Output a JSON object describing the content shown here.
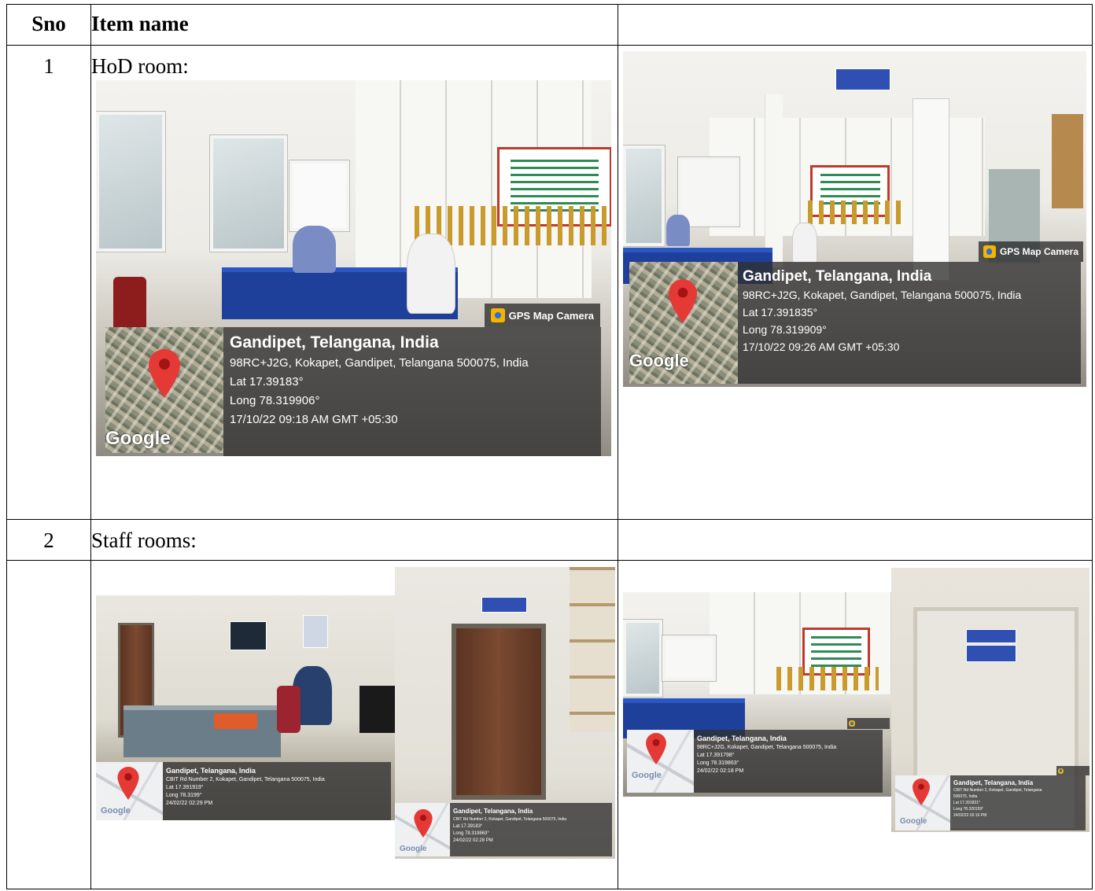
{
  "table": {
    "headers": {
      "sno": "Sno",
      "item": "Item name",
      "extra": ""
    },
    "rows": [
      {
        "sno": "1",
        "label": "HoD room:"
      },
      {
        "sno": "2",
        "label": "Staff rooms:"
      }
    ]
  },
  "photos": {
    "hod_left": {
      "badge": "GPS Map Camera",
      "place": "Gandipet, Telangana, India",
      "address": "98RC+J2G, Kokapet, Gandipet, Telangana 500075, India",
      "lat": "Lat 17.39183°",
      "long": "Long 78.319906°",
      "time": "17/10/22 09:18 AM GMT +05:30",
      "logo": "Google"
    },
    "hod_right": {
      "badge": "GPS Map Camera",
      "place": "Gandipet, Telangana, India",
      "address": "98RC+J2G, Kokapet, Gandipet, Telangana 500075, India",
      "lat": "Lat 17.391835°",
      "long": "Long 78.319909°",
      "time": "17/10/22 09:26 AM GMT +05:30",
      "logo": "Google"
    },
    "staff_1": {
      "place": "Gandipet, Telangana, India",
      "address": "CBIT Rd Number 2, Kokapet, Gandipet, Telangana 500075, India",
      "lat": "Lat 17.391919°",
      "long": "Long 78.3199°",
      "time": "24/02/22 02:29 PM",
      "logo": "Google"
    },
    "staff_2": {
      "place": "Gandipet, Telangana, India",
      "address": "CBIT Rd Number 2, Kokapet, Gandipet, Telangana 500075, India",
      "lat": "Lat 17.39183°",
      "long": "Long 78.319863°",
      "time": "24/02/22 02:28 PM",
      "logo": "Google"
    },
    "staff_3": {
      "place": "Gandipet, Telangana, India",
      "address": "98RC+J2G, Kokapet, Gandipet, Telangana 500075, India",
      "lat": "Lat 17.391798°",
      "long": "Long 78.319863°",
      "time": "24/02/22 02:18 PM",
      "logo": "Google"
    },
    "staff_4": {
      "place": "Gandipet, Telangana, India",
      "address": "CBIT Rd Number 2, Kokapet, Gandipet, Telangana",
      "line3": "500075, India",
      "lat": "Lat 17.391831°",
      "long": "Long 78.320159°",
      "time": "24/02/22 02:16 PM",
      "logo": "Google"
    }
  }
}
